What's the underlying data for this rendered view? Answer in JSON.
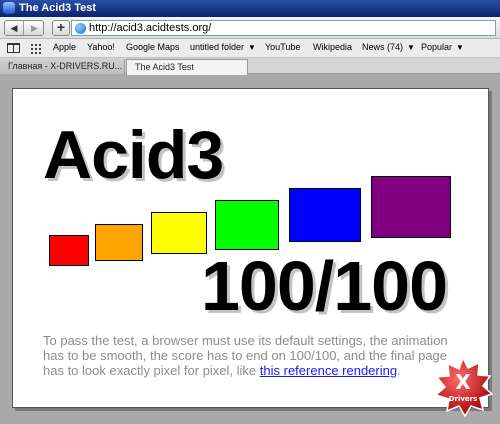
{
  "window": {
    "title": "The Acid3 Test"
  },
  "toolbar": {
    "back_glyph": "◀",
    "forward_glyph": "▶",
    "new_tab_glyph": "+",
    "url": "http://acid3.acidtests.org/"
  },
  "bookmarks": [
    {
      "label": "Apple"
    },
    {
      "label": "Yahoo!"
    },
    {
      "label": "Google Maps"
    },
    {
      "label": "untitled folder",
      "menu": true
    },
    {
      "label": "YouTube"
    },
    {
      "label": "Wikipedia"
    },
    {
      "label": "News (74)",
      "menu": true
    },
    {
      "label": "Popular",
      "menu": true
    }
  ],
  "tabs": [
    {
      "label": "Главная - X-DRIVERS.RU...",
      "active": false
    },
    {
      "label": "The Acid3 Test",
      "active": true
    }
  ],
  "page": {
    "heading": "Acid3",
    "score": "100/100",
    "description": "To pass the test, a browser must use its default settings, the animation has to be smooth, the score has to end on 100/100, and the final page has to look exactly pixel for pixel, like",
    "link_text": "this reference rendering",
    "trailing": ".",
    "buckets": [
      "#ff0000",
      "#ffa500",
      "#ffff00",
      "#00ff00",
      "#0000ff",
      "#800080"
    ]
  },
  "watermark": {
    "text": "X Drivers"
  }
}
